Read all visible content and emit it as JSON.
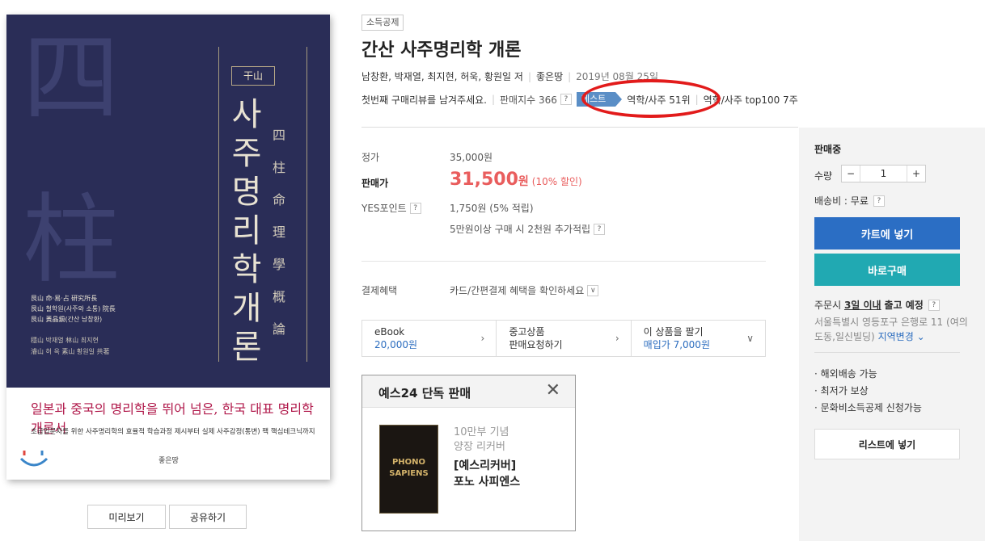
{
  "cover": {
    "big_char_top": "四",
    "big_char_bottom": "柱",
    "badge": "干山",
    "title_vertical": "사주명리학개론",
    "sub_vertical": "四柱命理學概論",
    "authors": [
      "艮山 命·易·占 研究所長",
      "艮山 철학원(사주와 소통) 院長",
      "艮山 黃晶鎭(간산 남창환)"
    ],
    "coauthors": [
      "穩山 박재열 林山 최지현",
      "濬山 허  옥 素山 황원일 共著"
    ],
    "tagline": "일본과 중국의 명리학을 뛰어 넘은, 한국 대표 명리학 개론서",
    "description": "초급입문자를 위한 사주명리학의 효율적 학습과정 제시부터 실제 사주감정(통변) 팩 핵심테크닉까지",
    "publisher": "좋은땅"
  },
  "under_cover": {
    "preview": "미리보기",
    "share": "공유하기"
  },
  "product": {
    "tag": "소득공제",
    "title": "간산 사주명리학 개론",
    "authors": "남창환, 박재열, 최지현, 허욱, 황원일 저",
    "publisher": "좋은땅",
    "date": "2019년 08월 25일",
    "review_prompt": "첫번째 구매리뷰를 남겨주세요.",
    "sales_index": "판매지수 366",
    "best_label": "베스트",
    "rank_1": "역학/사주 51위",
    "rank_2": "역학/사주 top100 7주"
  },
  "price": {
    "list_label": "정가",
    "list_value": "35,000원",
    "sale_label": "판매가",
    "sale_value": "31,500",
    "sale_unit": "원",
    "sale_pct": "(10% 할인)",
    "point_label": "YES포인트",
    "point_value": "1,750원 (5% 적립)",
    "point_extra": "5만원이상 구매 시 2천원 추가적립"
  },
  "payment": {
    "label": "결제혜택",
    "value": "카드/간편결제 혜택을 확인하세요"
  },
  "options": [
    {
      "line1": "eBook",
      "line2": "20,000원"
    },
    {
      "line1": "중고상품",
      "line2": "판매요청하기"
    },
    {
      "line1": "이 상품을 팔기",
      "line2": "매입가 7,000원"
    }
  ],
  "promo": {
    "title": "예스24 단독 판매",
    "sub1": "10만부 기념",
    "sub2": "양장 리커버",
    "name1": "[예스리커버]",
    "name2": "포노 사피엔스",
    "img_text1": "PHONO",
    "img_text2": "SAPIENS"
  },
  "side": {
    "status": "판매중",
    "qty_label": "수량",
    "qty_minus": "−",
    "qty_value": "1",
    "qty_plus": "+",
    "ship": "배송비 : 무료",
    "cart": "카트에 넣기",
    "buy": "바로구매",
    "deliv_prefix": "주문시",
    "deliv_days": "3일 이내",
    "deliv_suffix": "출고 예정",
    "addr": "서울특별시 영등포구 은행로 11 (여의도동,일신빌딩)",
    "addr_link": "지역변경",
    "features": [
      "· 해외배송 가능",
      "· 최저가 보상",
      "· 문화비소득공제 신청가능"
    ],
    "list_btn": "리스트에 넣기"
  }
}
